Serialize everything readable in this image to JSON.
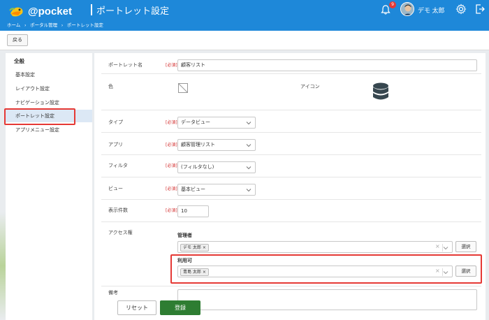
{
  "header": {
    "logo_text": "@pocket",
    "title": "ポートレット設定",
    "breadcrumb": [
      "ホーム",
      "›",
      "ポータル管理",
      "›",
      "ポートレット設定"
    ],
    "notification_count": "9",
    "username": "デモ 太郎",
    "brand_color": "#1e88d9"
  },
  "toolbar": {
    "back_label": "戻る"
  },
  "sidebar": {
    "heading": "全般",
    "items": [
      {
        "label": "基本設定"
      },
      {
        "label": "レイアウト設定"
      },
      {
        "label": "ナビゲーション設定"
      },
      {
        "label": "ポートレット設定"
      },
      {
        "label": "アプリメニュー設定"
      }
    ],
    "active_index": 3
  },
  "form": {
    "required_label": "[必須]",
    "portlet_name": {
      "label": "ポートレット名",
      "value": "顧客リスト"
    },
    "color": {
      "label": "色"
    },
    "icon": {
      "label": "アイコン",
      "icon_name": "database-icon"
    },
    "type": {
      "label": "タイプ",
      "value": "データビュー"
    },
    "app": {
      "label": "アプリ",
      "value": "顧客管理リスト"
    },
    "filter": {
      "label": "フィルタ",
      "value": "(フィルタなし)"
    },
    "view": {
      "label": "ビュー",
      "value": "基本ビュー"
    },
    "display_count": {
      "label": "表示件数",
      "value": "10"
    },
    "access": {
      "label": "アクセス権",
      "admin": {
        "label": "管理者",
        "tags": [
          "デモ 太郎"
        ]
      },
      "user": {
        "label": "利用可",
        "tags": [
          "青島 太郎"
        ]
      },
      "select_label": "選択",
      "clear_glyph": "×"
    },
    "remarks": {
      "label": "備考"
    }
  },
  "footer": {
    "reset_label": "リセット",
    "save_label": "登録",
    "save_color": "#2e7d32"
  },
  "highlight_color": "#e53935"
}
